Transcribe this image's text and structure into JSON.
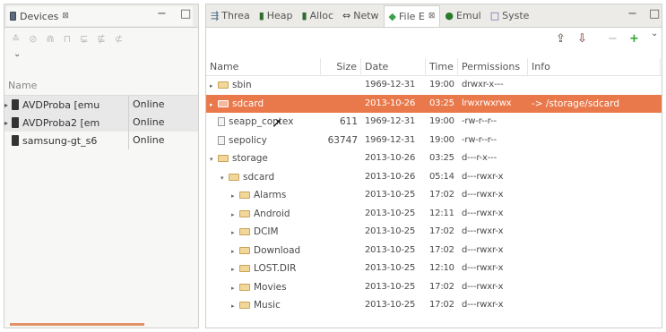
{
  "devices_panel": {
    "tab_label": "Devices",
    "tab_close": "⊠",
    "minimize": "−",
    "maximize": "□",
    "toolbar_icons": [
      "≛",
      "⊘",
      "⋒",
      "⊓",
      "⋤",
      "⋢",
      "⊄"
    ],
    "menu_arrow": "⌄",
    "column_name": "Name",
    "devices": [
      {
        "name": "AVDProba [emu",
        "status": "Online",
        "expandable": true
      },
      {
        "name": "AVDProba2 [em",
        "status": "Online",
        "expandable": true
      },
      {
        "name": "samsung-gt_s6",
        "status": "Online",
        "expandable": false
      }
    ]
  },
  "explorer_panel": {
    "tabs": [
      {
        "icon": "⇶",
        "label": "Threa"
      },
      {
        "icon": "▮",
        "label": "Heap"
      },
      {
        "icon": "▮",
        "label": "Alloc"
      },
      {
        "icon": "⇔",
        "label": "Netw"
      },
      {
        "icon": "◆",
        "label": "File E",
        "active": true,
        "close": "⊠"
      },
      {
        "icon": "●",
        "label": "Emul"
      },
      {
        "icon": "□",
        "label": "Syste"
      }
    ],
    "minimize": "−",
    "maximize": "□",
    "toolbar": {
      "pull": "⇪",
      "push": "⇩",
      "delete": "−",
      "new": "+",
      "menu": "⌄"
    },
    "columns": {
      "name": "Name",
      "size": "Size",
      "date": "Date",
      "time": "Time",
      "permissions": "Permissions",
      "info": "Info"
    },
    "rows": [
      {
        "depth": 0,
        "expanded": false,
        "type": "folder",
        "name": "sbin",
        "size": "",
        "date": "1969-12-31",
        "time": "19:00",
        "perm": "drwxr-x---",
        "info": ""
      },
      {
        "depth": 0,
        "expanded": false,
        "type": "link",
        "name": "sdcard",
        "size": "",
        "date": "2013-10-26",
        "time": "03:25",
        "perm": "lrwxrwxrwx",
        "info": "-> /storage/sdcard",
        "selected": true
      },
      {
        "depth": 0,
        "expanded": null,
        "type": "file",
        "name": "seapp_contex",
        "size": "611",
        "date": "1969-12-31",
        "time": "19:00",
        "perm": "-rw-r--r--",
        "info": ""
      },
      {
        "depth": 0,
        "expanded": null,
        "type": "file",
        "name": "sepolicy",
        "size": "63747",
        "date": "1969-12-31",
        "time": "19:00",
        "perm": "-rw-r--r--",
        "info": ""
      },
      {
        "depth": 0,
        "expanded": true,
        "type": "folder",
        "name": "storage",
        "size": "",
        "date": "2013-10-26",
        "time": "03:25",
        "perm": "d---r-x---",
        "info": ""
      },
      {
        "depth": 1,
        "expanded": true,
        "type": "folder",
        "name": "sdcard",
        "size": "",
        "date": "2013-10-26",
        "time": "05:14",
        "perm": "d---rwxr-x",
        "info": ""
      },
      {
        "depth": 2,
        "expanded": false,
        "type": "folder",
        "name": "Alarms",
        "size": "",
        "date": "2013-10-25",
        "time": "17:02",
        "perm": "d---rwxr-x",
        "info": ""
      },
      {
        "depth": 2,
        "expanded": false,
        "type": "folder",
        "name": "Android",
        "size": "",
        "date": "2013-10-25",
        "time": "12:11",
        "perm": "d---rwxr-x",
        "info": ""
      },
      {
        "depth": 2,
        "expanded": false,
        "type": "folder",
        "name": "DCIM",
        "size": "",
        "date": "2013-10-25",
        "time": "17:02",
        "perm": "d---rwxr-x",
        "info": ""
      },
      {
        "depth": 2,
        "expanded": false,
        "type": "folder",
        "name": "Download",
        "size": "",
        "date": "2013-10-25",
        "time": "17:02",
        "perm": "d---rwxr-x",
        "info": ""
      },
      {
        "depth": 2,
        "expanded": false,
        "type": "folder",
        "name": "LOST.DIR",
        "size": "",
        "date": "2013-10-25",
        "time": "12:10",
        "perm": "d---rwxr-x",
        "info": ""
      },
      {
        "depth": 2,
        "expanded": false,
        "type": "folder",
        "name": "Movies",
        "size": "",
        "date": "2013-10-25",
        "time": "17:02",
        "perm": "d---rwxr-x",
        "info": ""
      },
      {
        "depth": 2,
        "expanded": false,
        "type": "folder",
        "name": "Music",
        "size": "",
        "date": "2013-10-25",
        "time": "17:02",
        "perm": "d---rwxr-x",
        "info": ""
      }
    ]
  },
  "colors": {
    "selection": "#e9784a",
    "accent_line": "#e4926b",
    "folder": "#f2d79a"
  }
}
